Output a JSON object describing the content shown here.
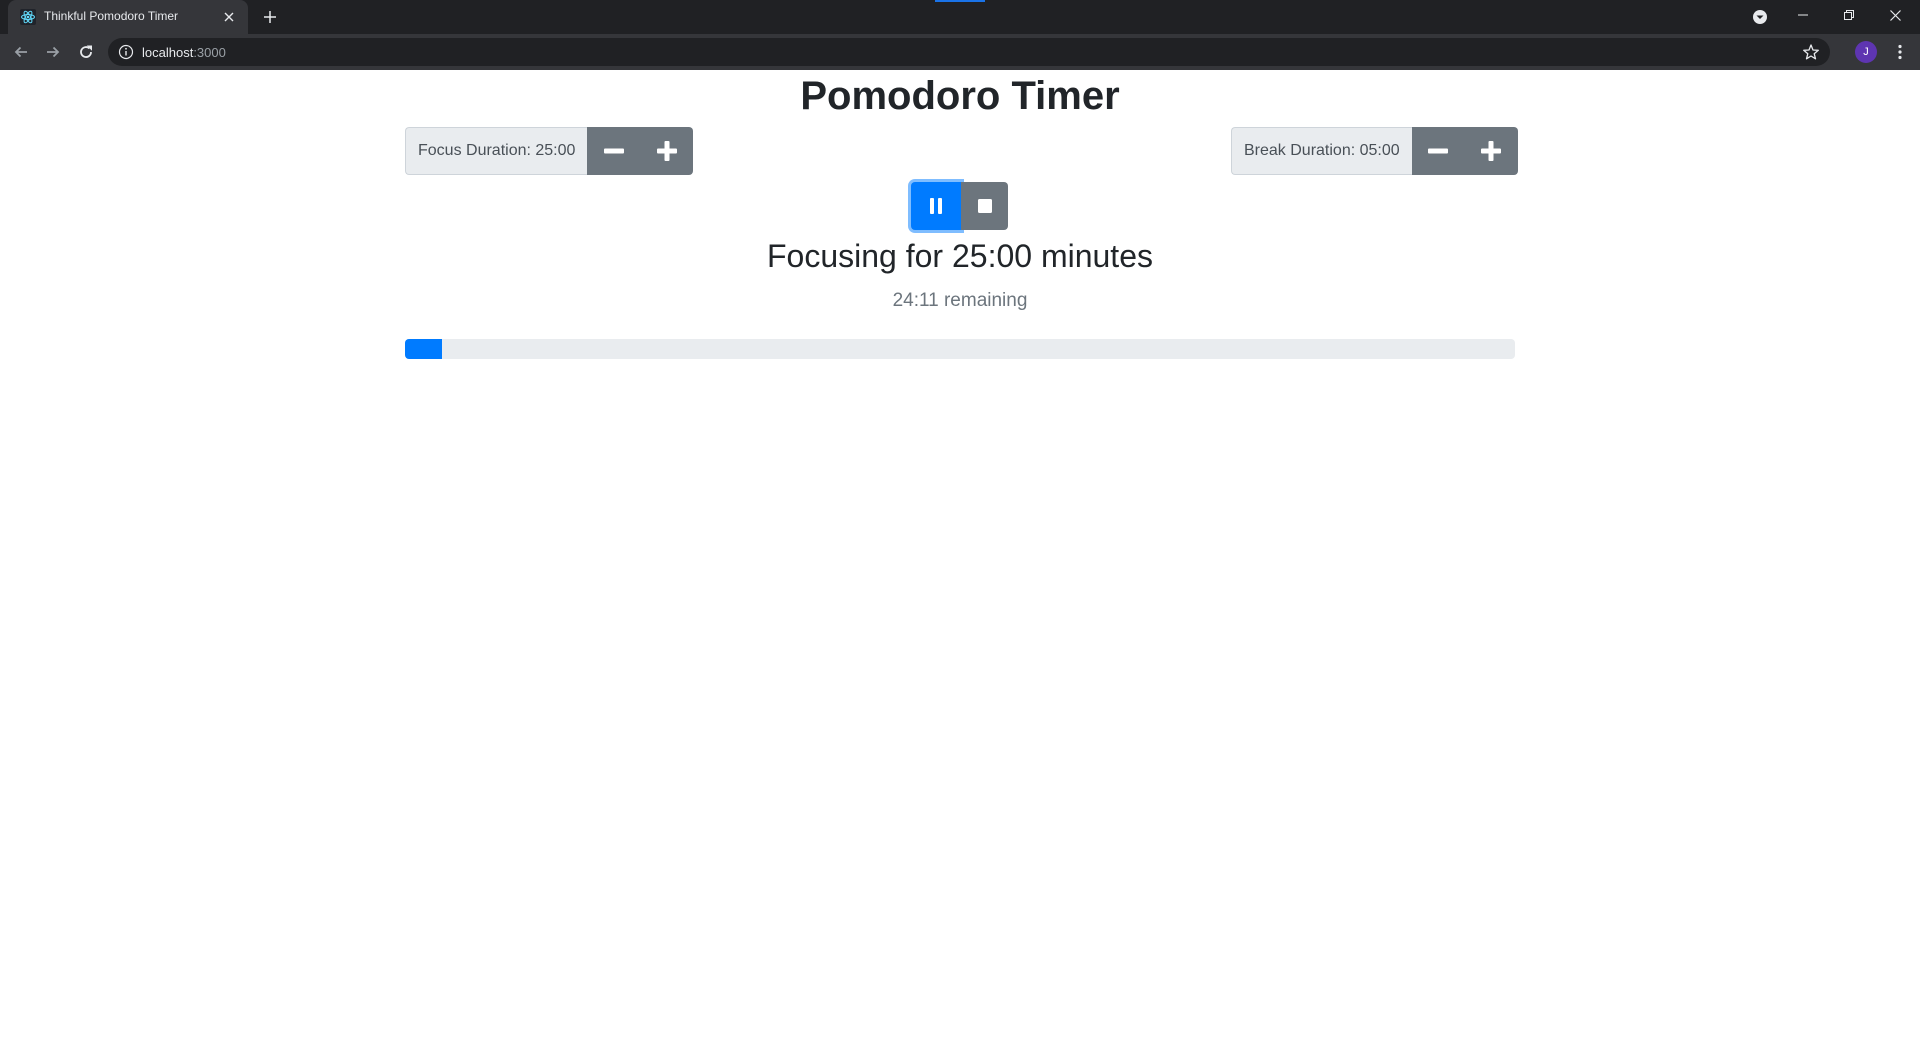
{
  "browser": {
    "tab": {
      "title": "Thinkful Pomodoro Timer",
      "favicon": "react-atom-icon"
    },
    "url": {
      "host": "localhost",
      "port": ":3000"
    },
    "profile_initial": "J"
  },
  "page": {
    "title": "Pomodoro Timer",
    "focus": {
      "label": "Focus Duration: 25:00"
    },
    "break": {
      "label": "Break Duration: 05:00"
    },
    "session": {
      "title": "Focusing for 25:00 minutes",
      "remaining": "24:11 remaining",
      "progress_percent": 3.3
    }
  },
  "colors": {
    "primary": "#007bff",
    "secondary": "#6c757d",
    "text": "#212529",
    "muted": "#6c757d",
    "track": "#e9ecef"
  }
}
